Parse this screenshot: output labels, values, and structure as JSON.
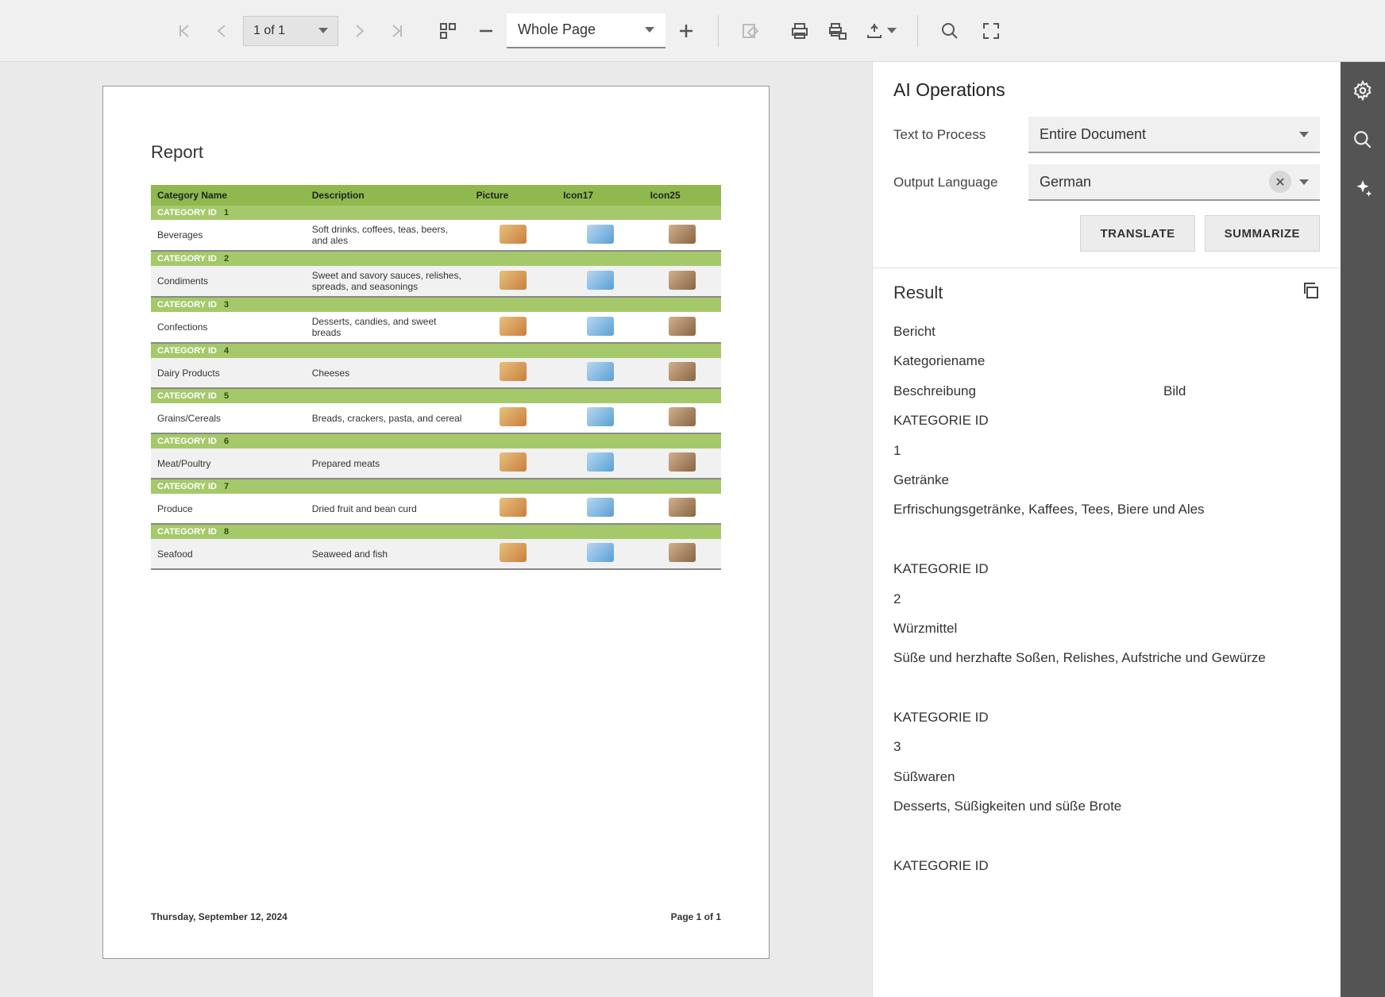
{
  "toolbar": {
    "page_display": "1 of 1",
    "zoom_display": "Whole Page"
  },
  "report": {
    "title": "Report",
    "columns": [
      "Category Name",
      "Description",
      "Picture",
      "Icon17",
      "Icon25"
    ],
    "category_label": "CATEGORY ID",
    "rows": [
      {
        "id": "1",
        "name": "Beverages",
        "desc": "Soft drinks, coffees, teas, beers, and ales",
        "shaded": false
      },
      {
        "id": "2",
        "name": "Condiments",
        "desc": "Sweet and savory sauces, relishes, spreads, and seasonings",
        "shaded": true
      },
      {
        "id": "3",
        "name": "Confections",
        "desc": "Desserts, candies, and sweet breads",
        "shaded": false
      },
      {
        "id": "4",
        "name": "Dairy Products",
        "desc": "Cheeses",
        "shaded": true
      },
      {
        "id": "5",
        "name": "Grains/Cereals",
        "desc": "Breads, crackers, pasta, and cereal",
        "shaded": false
      },
      {
        "id": "6",
        "name": "Meat/Poultry",
        "desc": "Prepared meats",
        "shaded": true
      },
      {
        "id": "7",
        "name": "Produce",
        "desc": "Dried fruit and bean curd",
        "shaded": false
      },
      {
        "id": "8",
        "name": "Seafood",
        "desc": "Seaweed and fish",
        "shaded": true
      }
    ],
    "footer_date": "Thursday, September 12, 2024",
    "footer_page": "Page 1 of 1"
  },
  "panel": {
    "title": "AI Operations",
    "text_to_process_label": "Text to Process",
    "text_to_process_value": "Entire Document",
    "output_language_label": "Output Language",
    "output_language_value": "German",
    "translate_label": "TRANSLATE",
    "summarize_label": "SUMMARIZE",
    "result_title": "Result",
    "result_lines": [
      "Bericht",
      "Kategoriename",
      "Beschreibung",
      "KATEGORIE ID",
      "1",
      "Getränke",
      "Erfrischungsgetränke, Kaffees, Tees, Biere und Ales",
      "",
      "KATEGORIE ID",
      "2",
      "Würzmittel",
      "Süße und herzhafte Soßen, Relishes, Aufstriche und Gewürze",
      "",
      "KATEGORIE ID",
      "3",
      "Süßwaren",
      "Desserts, Süßigkeiten und süße Brote",
      "",
      "KATEGORIE ID"
    ],
    "result_bild": "Bild"
  }
}
